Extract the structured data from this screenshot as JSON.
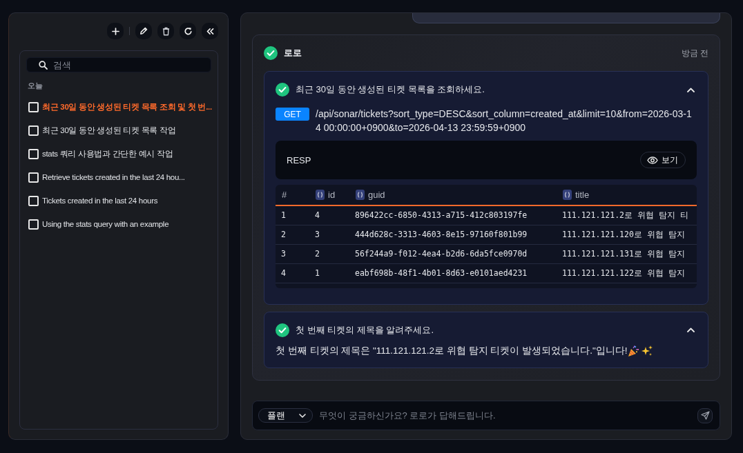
{
  "sidebar": {
    "search": {
      "placeholder": "검색"
    },
    "groups": [
      {
        "label": "오늘",
        "items": [
          {
            "title": "최근 30일 동안 생성된 티켓 목록 조회 및 첫 번...",
            "selected": true,
            "checked": false
          },
          {
            "title": "최근 30일 동안 생성된 티켓 목록 작업",
            "selected": false,
            "checked": false
          },
          {
            "title": "stats 쿼리 사용법과 간단한 예시 작업",
            "selected": false,
            "checked": false
          },
          {
            "title": "Retrieve tickets created in the last 24 hou...",
            "selected": false,
            "checked": false
          },
          {
            "title": "Tickets created in the last 24 hours",
            "selected": false,
            "checked": false
          },
          {
            "title": "Using the stats query with an example",
            "selected": false,
            "checked": false
          }
        ]
      }
    ]
  },
  "chat": {
    "message": {
      "sender": "로로",
      "time": "방금 전",
      "done": true,
      "steps": [
        {
          "kind": "api_call",
          "title": "최근 30일 동안 생성된 티켓 목록을 조회하세요.",
          "done": true,
          "expanded": true,
          "method": "GET",
          "path": "/api/sonar/tickets?sort_type=DESC&sort_column=created_at&limit=10&from=2026-03-14 00:00:00+0900&to=2026-04-13 23:59:59+0900",
          "response": {
            "label": "RESP",
            "view_button": "보기",
            "table": {
              "columns": [
                {
                  "label": "#",
                  "kind": "index"
                },
                {
                  "label": "id",
                  "kind": "field"
                },
                {
                  "label": "guid",
                  "kind": "field"
                },
                {
                  "label": "title",
                  "kind": "field"
                }
              ],
              "rows": [
                [
                  "1",
                  "4",
                  "896422cc-6850-4313-a715-412c803197fe",
                  "111.121.121.2로 위협 탐지 티"
                ],
                [
                  "2",
                  "3",
                  "444d628c-3313-4603-8e15-97160f801b99",
                  "111.121.121.120로 위협 탐지"
                ],
                [
                  "3",
                  "2",
                  "56f244a9-f012-4ea4-b2d6-6da5fce0970d",
                  "111.121.121.131로 위협 탐지"
                ],
                [
                  "4",
                  "1",
                  "eabf698b-48f1-4b01-8d63-e0101aed4231",
                  "111.121.121.122로 위협 탐지"
                ]
              ]
            }
          }
        },
        {
          "kind": "answer",
          "title": "첫 번째 티켓의 제목을 알려주세요.",
          "done": true,
          "expanded": true,
          "answer": "첫 번째 티켓의 제목은 \"111.121.121.2로 위협 탐지 티켓이 발생되었습니다.\"입니다!"
        }
      ]
    }
  },
  "composer": {
    "mode": "플랜",
    "placeholder": "무엇이 궁금하신가요? 로로가 답해드립니다."
  }
}
